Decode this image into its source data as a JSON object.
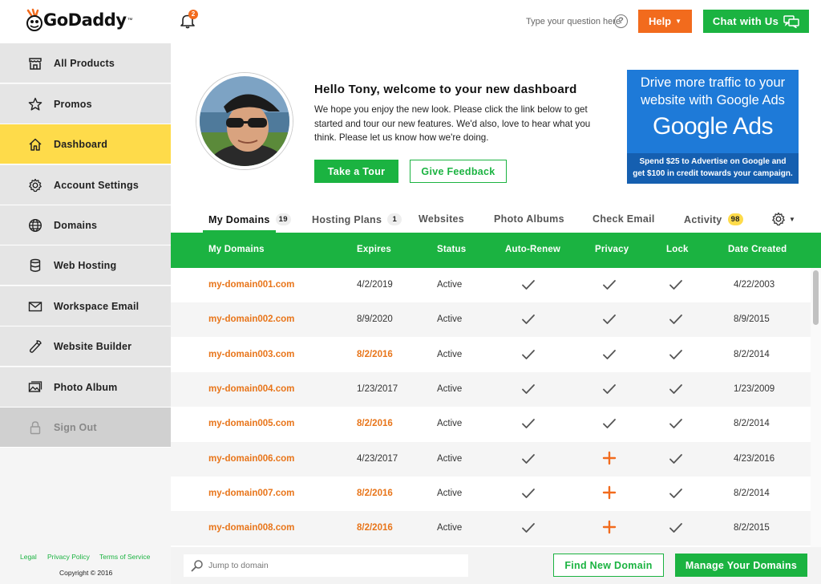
{
  "header": {
    "logo_text": "GoDaddy",
    "logo_tm": "™",
    "notification_count": "2",
    "search_prompt": "Type your question here",
    "help_label": "Help",
    "chat_label": "Chat with Us"
  },
  "sidebar": {
    "items": [
      {
        "label": "All Products",
        "icon": "storefront-icon"
      },
      {
        "label": "Promos",
        "icon": "star-icon"
      },
      {
        "label": "Dashboard",
        "icon": "home-icon"
      },
      {
        "label": "Account Settings",
        "icon": "gear-icon"
      },
      {
        "label": "Domains",
        "icon": "globe-icon"
      },
      {
        "label": "Web Hosting",
        "icon": "database-icon"
      },
      {
        "label": "Workspace Email",
        "icon": "envelope-icon"
      },
      {
        "label": "Website Builder",
        "icon": "wrench-icon"
      },
      {
        "label": "Photo Album",
        "icon": "photo-icon"
      },
      {
        "label": "Sign Out",
        "icon": "lock-icon"
      }
    ],
    "active_index": 2,
    "footer": {
      "legal": "Legal",
      "privacy": "Privacy Policy",
      "terms": "Terms of Service",
      "copyright": "Copyright © 2016"
    }
  },
  "welcome": {
    "title": "Hello Tony, welcome to your new dashboard",
    "body": "We hope you enjoy the new look. Please click the link below to get started and tour our new features. We'd also, love to hear what you think. Please let us know how we're doing.",
    "tour_label": "Take a Tour",
    "feedback_label": "Give Feedback"
  },
  "ad": {
    "line1": "Drive more traffic to your",
    "line2": "website with Google Ads",
    "brand": "Google Ads",
    "small1": "Spend $25 to Advertise on Google and",
    "small2": "get $100 in credit towards your campaign."
  },
  "tabs": [
    {
      "label": "My Domains",
      "count": "19"
    },
    {
      "label": "Hosting Plans",
      "count": "1"
    },
    {
      "label": "Websites",
      "count": ""
    },
    {
      "label": "Photo Albums",
      "count": ""
    },
    {
      "label": "Check Email",
      "count": ""
    },
    {
      "label": "Activity",
      "count": "98"
    }
  ],
  "table": {
    "headers": [
      "My Domains",
      "Expires",
      "Status",
      "Auto-Renew",
      "Privacy",
      "Lock",
      "Date Created"
    ],
    "rows": [
      {
        "domain": "my-domain001.com",
        "expires": "4/2/2019",
        "expired": false,
        "status": "Active",
        "auto_renew": true,
        "privacy": true,
        "lock": true,
        "created": "4/22/2003"
      },
      {
        "domain": "my-domain002.com",
        "expires": "8/9/2020",
        "expired": false,
        "status": "Active",
        "auto_renew": true,
        "privacy": true,
        "lock": true,
        "created": "8/9/2015"
      },
      {
        "domain": "my-domain003.com",
        "expires": "8/2/2016",
        "expired": true,
        "status": "Active",
        "auto_renew": true,
        "privacy": true,
        "lock": true,
        "created": "8/2/2014"
      },
      {
        "domain": "my-domain004.com",
        "expires": "1/23/2017",
        "expired": false,
        "status": "Active",
        "auto_renew": true,
        "privacy": true,
        "lock": true,
        "created": "1/23/2009"
      },
      {
        "domain": "my-domain005.com",
        "expires": "8/2/2016",
        "expired": true,
        "status": "Active",
        "auto_renew": true,
        "privacy": true,
        "lock": true,
        "created": "8/2/2014"
      },
      {
        "domain": "my-domain006.com",
        "expires": "4/23/2017",
        "expired": false,
        "status": "Active",
        "auto_renew": true,
        "privacy": false,
        "lock": true,
        "created": "4/23/2016"
      },
      {
        "domain": "my-domain007.com",
        "expires": "8/2/2016",
        "expired": true,
        "status": "Active",
        "auto_renew": true,
        "privacy": false,
        "lock": true,
        "created": "8/2/2014"
      },
      {
        "domain": "my-domain008.com",
        "expires": "8/2/2016",
        "expired": true,
        "status": "Active",
        "auto_renew": true,
        "privacy": false,
        "lock": true,
        "created": "8/2/2015"
      }
    ]
  },
  "bottom": {
    "jump_placeholder": "Jump to domain",
    "find_label": "Find New Domain",
    "manage_label": "Manage Your Domains"
  },
  "colors": {
    "brand_green": "#1bb341",
    "accent_orange": "#f26b1d",
    "active_yellow": "#fedb4a",
    "ad_blue": "#1e7ad8"
  }
}
